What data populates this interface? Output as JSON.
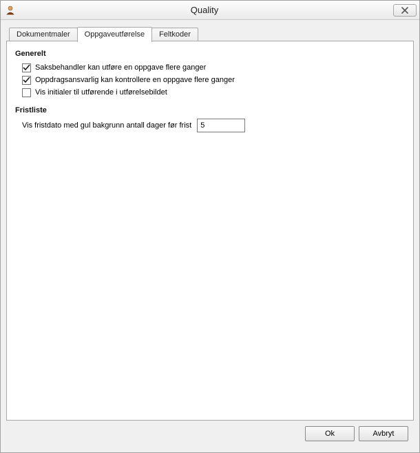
{
  "window": {
    "title": "Quality"
  },
  "tabs": [
    {
      "label": "Dokumentmaler",
      "active": false
    },
    {
      "label": "Oppgaveutførelse",
      "active": true
    },
    {
      "label": "Feltkoder",
      "active": false
    }
  ],
  "sections": {
    "general": {
      "header": "Generelt",
      "options": [
        {
          "checked": true,
          "label": "Saksbehandler kan utføre en oppgave flere ganger"
        },
        {
          "checked": true,
          "label": "Oppdragsansvarlig kan kontrollere en oppgave flere ganger"
        },
        {
          "checked": false,
          "label": "Vis initialer til utførende i utførelsebildet"
        }
      ]
    },
    "deadline": {
      "header": "Fristliste",
      "field_label": "Vis fristdato med gul bakgrunn antall dager før frist",
      "field_value": "5"
    }
  },
  "buttons": {
    "ok": "Ok",
    "cancel": "Avbryt"
  }
}
